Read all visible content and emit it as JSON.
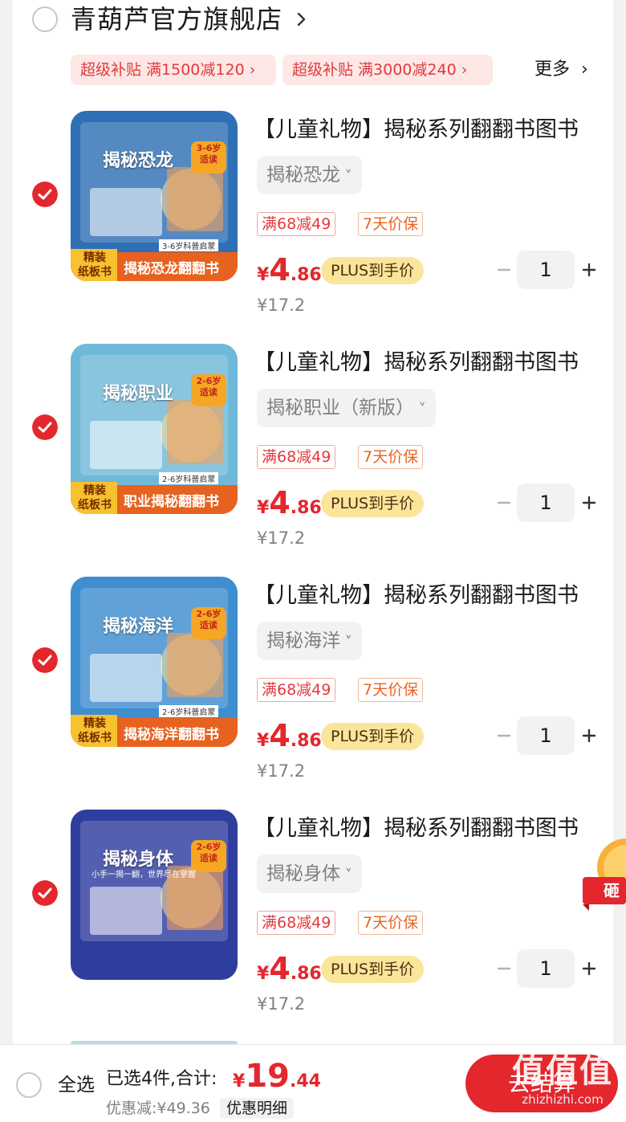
{
  "shop": {
    "name": "青葫芦官方旗舰店",
    "coupons": [
      "超级补贴 满1500减120",
      "超级补贴 满3000减240"
    ],
    "more_label": "更多"
  },
  "items": [
    {
      "title": "【儿童礼物】揭秘系列翻翻书图书",
      "spec": "揭秘恐龙",
      "tags": [
        "满68减49",
        "7天价保"
      ],
      "price_currency": "¥",
      "price_int": "4",
      "price_dec": ".86",
      "plus_label": "PLUS到手价",
      "original_price": "¥17.2",
      "quantity": "1",
      "checked": true,
      "cover": {
        "title": "揭秘恐龙",
        "subtitle": "揭秘恐龙翻翻书",
        "badge": "精装\n纸板书",
        "age": "3-6岁\n适读",
        "age_band": "3-6岁科普启蒙",
        "bg": "#2f6fb5",
        "accent": "#e8621f"
      }
    },
    {
      "title": "【儿童礼物】揭秘系列翻翻书图书",
      "spec": "揭秘职业（新版）",
      "tags": [
        "满68减49",
        "7天价保"
      ],
      "price_currency": "¥",
      "price_int": "4",
      "price_dec": ".86",
      "plus_label": "PLUS到手价",
      "original_price": "¥17.2",
      "quantity": "1",
      "checked": true,
      "cover": {
        "title": "揭秘职业",
        "subtitle": "职业揭秘翻翻书",
        "badge": "精装\n纸板书",
        "age": "2-6岁\n适读",
        "age_band": "2-6岁科普启蒙",
        "bg": "#6fb9d8",
        "accent": "#e8621f"
      }
    },
    {
      "title": "【儿童礼物】揭秘系列翻翻书图书",
      "spec": "揭秘海洋",
      "tags": [
        "满68减49",
        "7天价保"
      ],
      "price_currency": "¥",
      "price_int": "4",
      "price_dec": ".86",
      "plus_label": "PLUS到手价",
      "original_price": "¥17.2",
      "quantity": "1",
      "checked": true,
      "cover": {
        "title": "揭秘海洋",
        "subtitle": "揭秘海洋翻翻书",
        "badge": "精装\n纸板书",
        "age": "2-6岁\n适读",
        "age_band": "2-6岁科普启蒙",
        "bg": "#3e8ed0",
        "accent": "#e8621f"
      }
    },
    {
      "title": "【儿童礼物】揭秘系列翻翻书图书",
      "spec": "揭秘身体",
      "tags": [
        "满68减49",
        "7天价保"
      ],
      "price_currency": "¥",
      "price_int": "4",
      "price_dec": ".86",
      "plus_label": "PLUS到手价",
      "original_price": "¥17.2",
      "quantity": "1",
      "checked": true,
      "cover": {
        "title": "揭秘身体",
        "subtitle": "小手一揭一翻，世界尽在掌握",
        "badge": "",
        "age": "2-6岁\n适读",
        "age_band": "",
        "bg": "#2f3e9e",
        "accent": "#e8621f"
      }
    }
  ],
  "float_badge": {
    "label": "砸"
  },
  "bottom": {
    "all_label": "全选",
    "selected_prefix": "已选4件,合计:",
    "total_currency": "¥",
    "total_int": "19",
    "total_dec": ".44",
    "discount_text": "优惠减:¥49.36",
    "detail_label": "优惠明细",
    "checkout_label": "去结算"
  },
  "watermark": {
    "main": "值值值",
    "sub": "zhizhizhi.com"
  },
  "colors": {
    "accent_red": "#e4262d",
    "coupon_bg": "#fde8e6",
    "plus_gold": "#fbe59a"
  }
}
